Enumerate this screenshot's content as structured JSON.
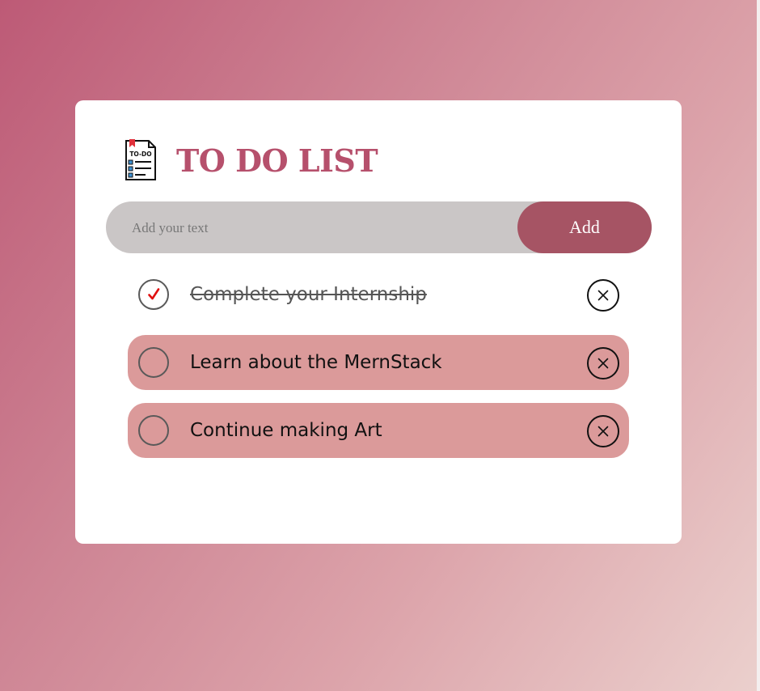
{
  "app": {
    "title": "TO DO LIST",
    "logo_icon": "to-do-checklist-icon",
    "logo_text": "TO-DO"
  },
  "input": {
    "placeholder": "Add your text",
    "value": ""
  },
  "add_button": {
    "label": "Add"
  },
  "tasks": [
    {
      "text": "Complete your Internship",
      "checked": true
    },
    {
      "text": "Learn about the MernStack",
      "checked": false
    },
    {
      "text": "Continue making Art",
      "checked": false
    }
  ],
  "icons": {
    "check": "check-icon",
    "remove": "close-icon"
  },
  "colors": {
    "accent_title": "#b6506c",
    "button": "#a65464",
    "input_background": "#cac6c6",
    "pending_task": "#db9a9a",
    "check_mark": "#e01010",
    "card": "#ffffff"
  }
}
